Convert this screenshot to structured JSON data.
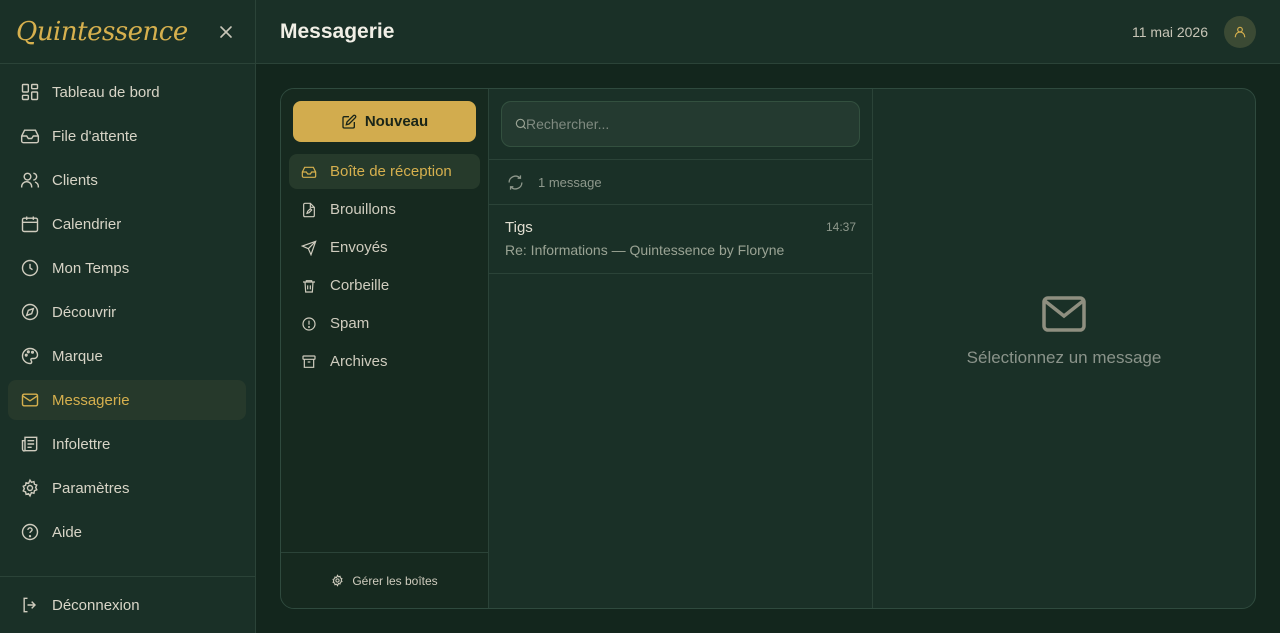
{
  "brand": {
    "logo_text": "Quintessence",
    "accent": "#d6b04e"
  },
  "sidebar": {
    "items": [
      {
        "label": "Tableau de bord",
        "icon": "dashboard-icon"
      },
      {
        "label": "File d'attente",
        "icon": "inbox-tray-icon"
      },
      {
        "label": "Clients",
        "icon": "users-icon"
      },
      {
        "label": "Calendrier",
        "icon": "calendar-icon"
      },
      {
        "label": "Mon Temps",
        "icon": "clock-icon"
      },
      {
        "label": "Découvrir",
        "icon": "compass-icon"
      },
      {
        "label": "Marque",
        "icon": "palette-icon"
      },
      {
        "label": "Messagerie",
        "icon": "mail-icon",
        "active": true
      },
      {
        "label": "Infolettre",
        "icon": "newspaper-icon"
      },
      {
        "label": "Paramètres",
        "icon": "gear-icon"
      },
      {
        "label": "Aide",
        "icon": "help-circle-icon"
      }
    ],
    "logout_label": "Déconnexion"
  },
  "header": {
    "title": "Messagerie",
    "date": "11 mai 2026"
  },
  "mail": {
    "new_label": "Nouveau",
    "folders": [
      {
        "label": "Boîte de réception",
        "icon": "inbox-icon",
        "active": true
      },
      {
        "label": "Brouillons",
        "icon": "draft-file-icon"
      },
      {
        "label": "Envoyés",
        "icon": "send-icon"
      },
      {
        "label": "Corbeille",
        "icon": "trash-icon"
      },
      {
        "label": "Spam",
        "icon": "alert-circle-icon"
      },
      {
        "label": "Archives",
        "icon": "archive-icon"
      }
    ],
    "manage_label": "Gérer les boîtes",
    "search_placeholder": "Rechercher...",
    "count_text": "1 message",
    "messages": [
      {
        "from": "Tigs",
        "time": "14:37",
        "subject": "Re: Informations — Quintessence by Floryne"
      }
    ],
    "empty_reader_text": "Sélectionnez un message"
  }
}
